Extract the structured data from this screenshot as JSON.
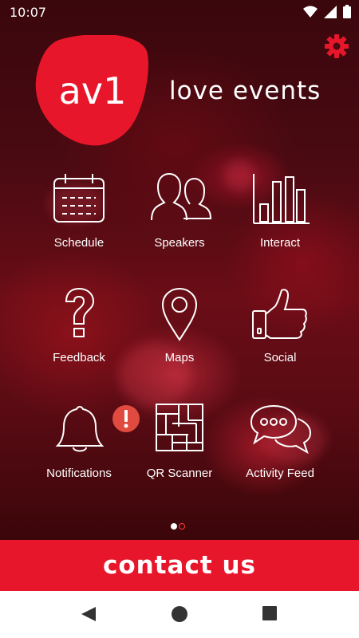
{
  "status_bar": {
    "time": "10:07",
    "icons": [
      "wifi-icon",
      "signal-icon",
      "battery-icon"
    ]
  },
  "brand": {
    "logo_text": "av1",
    "tagline": "love events",
    "accent_color": "#e8162a"
  },
  "settings": {
    "icon": "gear-icon"
  },
  "tiles": [
    {
      "label": "Schedule",
      "icon": "calendar-icon"
    },
    {
      "label": "Speakers",
      "icon": "people-icon"
    },
    {
      "label": "Interact",
      "icon": "bar-chart-icon"
    },
    {
      "label": "Feedback",
      "icon": "question-icon"
    },
    {
      "label": "Maps",
      "icon": "map-pin-icon"
    },
    {
      "label": "Social",
      "icon": "thumbs-up-icon"
    },
    {
      "label": "Notifications",
      "icon": "bell-icon",
      "badge": "!"
    },
    {
      "label": "QR Scanner",
      "icon": "qr-code-icon"
    },
    {
      "label": "Activity Feed",
      "icon": "chat-bubbles-icon"
    }
  ],
  "pager": {
    "pages": 2,
    "current": 1
  },
  "contact_button": {
    "label": "contact us"
  },
  "nav_bar": {
    "buttons": [
      "back-icon",
      "home-icon",
      "recents-icon"
    ]
  }
}
